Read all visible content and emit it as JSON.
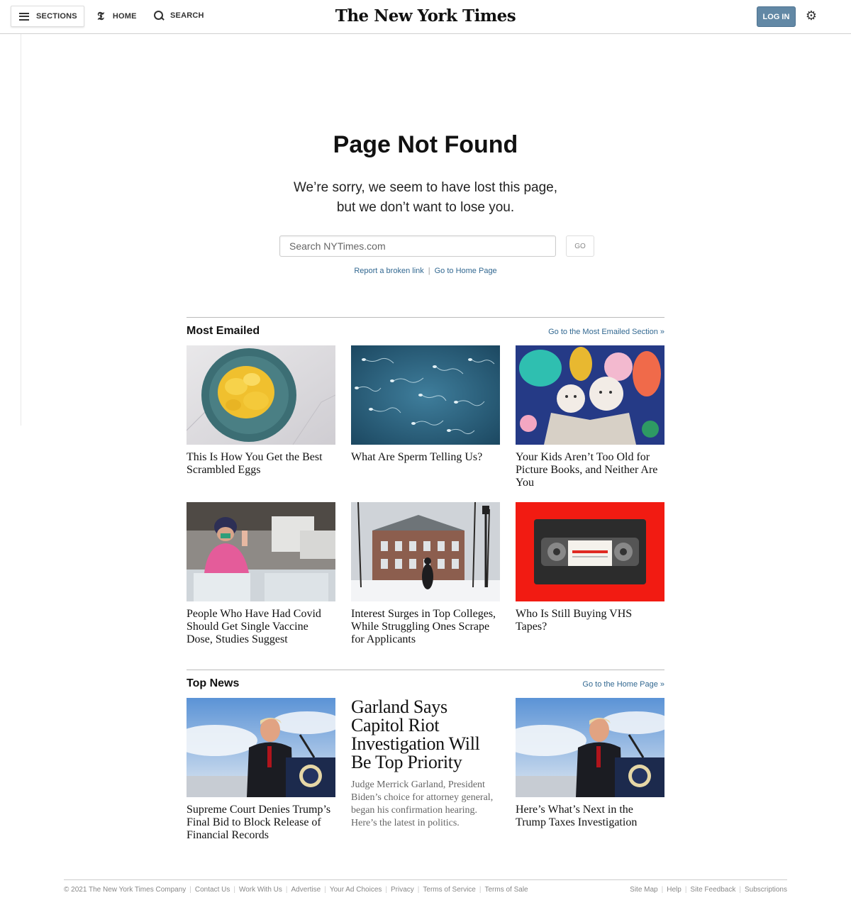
{
  "header": {
    "sections_label": "SECTIONS",
    "home_label": "HOME",
    "search_label": "SEARCH",
    "logo": "The New York Times",
    "login_label": "LOG IN"
  },
  "not_found": {
    "title": "Page Not Found",
    "message_line1": "We’re sorry, we seem to have lost this page,",
    "message_line2": "but we don’t want to lose you.",
    "search_placeholder": "Search NYTimes.com",
    "go_label": "GO",
    "report_link": "Report a broken link",
    "home_link": "Go to Home Page"
  },
  "most_emailed": {
    "heading": "Most Emailed",
    "section_link": "Go to the Most Emailed Section »",
    "items": [
      {
        "headline": "This Is How You Get the Best Scrambled Eggs"
      },
      {
        "headline": "What Are Sperm Telling Us?"
      },
      {
        "headline": "Your Kids Aren’t Too Old for Picture Books, and Neither Are You"
      },
      {
        "headline": "People Who Have Had Covid Should Get Single Vaccine Dose, Studies Suggest"
      },
      {
        "headline": "Interest Surges in Top Colleges, While Struggling Ones Scrape for Applicants"
      },
      {
        "headline": "Who Is Still Buying VHS Tapes?"
      }
    ]
  },
  "top_news": {
    "heading": "Top News",
    "section_link": "Go to the Home Page »",
    "left": {
      "headline": "Supreme Court Denies Trump’s Final Bid to Block Release of Financial Records"
    },
    "center": {
      "headline": "Garland Says Capitol Riot Investigation Will Be Top Priority",
      "summary": "Judge Merrick Garland, President Biden’s choice for attorney general, began his confirmation hearing. Here’s the latest in politics."
    },
    "right": {
      "headline": "Here’s What’s Next in the Trump Taxes Investigation"
    }
  },
  "footer": {
    "copyright": "© 2021 The New York Times Company",
    "left_links": [
      "Contact Us",
      "Work With Us",
      "Advertise",
      "Your Ad Choices",
      "Privacy",
      "Terms of Service",
      "Terms of Sale"
    ],
    "right_links": [
      "Site Map",
      "Help",
      "Site Feedback",
      "Subscriptions"
    ]
  },
  "colors": {
    "link_blue": "#326891",
    "login_bg": "#6288a5"
  }
}
